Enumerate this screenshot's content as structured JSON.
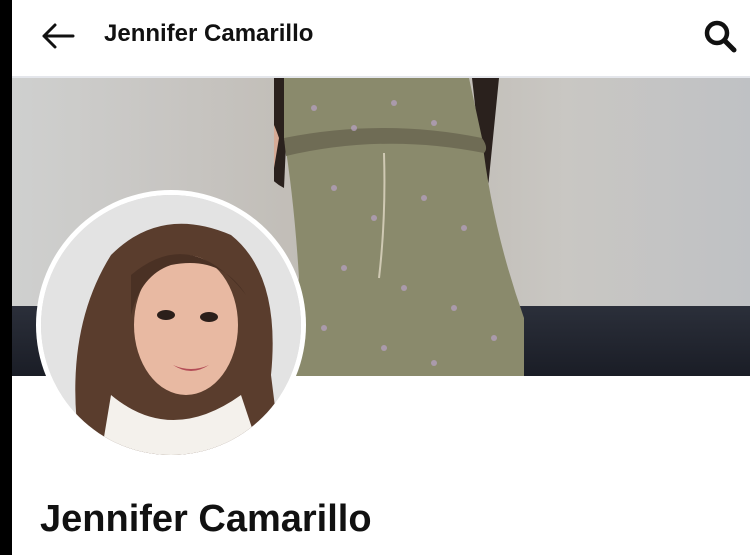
{
  "header": {
    "title": "Jennifer Camarillo",
    "back_icon": "arrow-left-icon",
    "search_icon": "search-icon"
  },
  "cover": {
    "description_icon": "cover-photo"
  },
  "profile": {
    "name": "Jennifer Camarillo",
    "avatar_icon": "profile-photo"
  },
  "colors": {
    "text": "#111111",
    "divider": "#e4e6eb",
    "background": "#ffffff"
  }
}
